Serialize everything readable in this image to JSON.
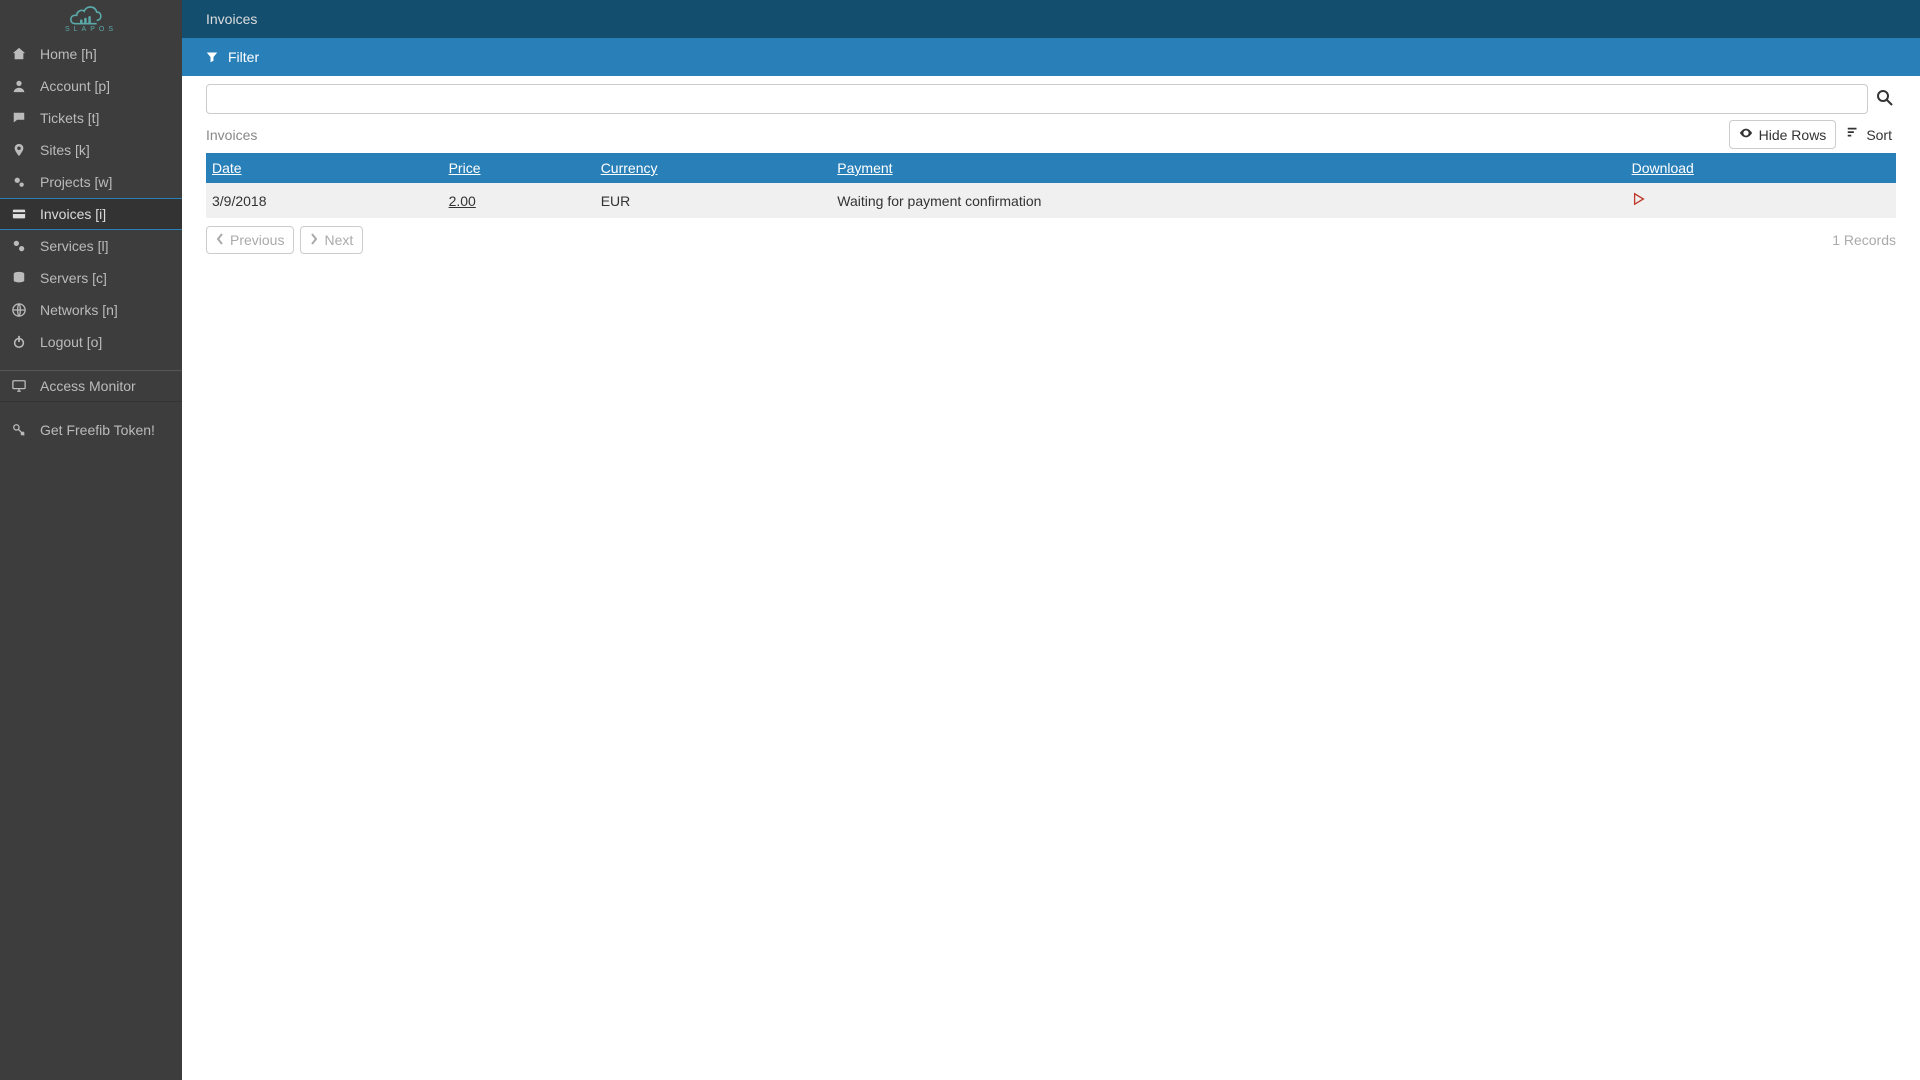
{
  "logo": {
    "text": "SLAPOS"
  },
  "sidebar": {
    "items": [
      {
        "label": "Home [h]",
        "icon": "home-icon"
      },
      {
        "label": "Account [p]",
        "icon": "user-icon"
      },
      {
        "label": "Tickets [t]",
        "icon": "chat-icon"
      },
      {
        "label": "Sites [k]",
        "icon": "pin-icon"
      },
      {
        "label": "Projects [w]",
        "icon": "gears-icon"
      },
      {
        "label": "Invoices [i]",
        "icon": "card-icon",
        "active": true
      },
      {
        "label": "Services [l]",
        "icon": "cogs-icon"
      },
      {
        "label": "Servers [c]",
        "icon": "db-icon"
      },
      {
        "label": "Networks [n]",
        "icon": "globe-icon"
      },
      {
        "label": "Logout [o]",
        "icon": "power-icon"
      }
    ],
    "extra": [
      {
        "label": "Access Monitor",
        "icon": "monitor-icon"
      },
      {
        "label": "Get Freefib Token!",
        "icon": "key-icon"
      }
    ]
  },
  "header": {
    "title": "Invoices"
  },
  "filterbar": {
    "label": "Filter"
  },
  "search": {
    "value": ""
  },
  "section": {
    "title": "Invoices",
    "hide_rows": "Hide Rows",
    "sort": "Sort"
  },
  "table": {
    "columns": {
      "date": "Date",
      "price": "Price",
      "currency": "Currency",
      "payment": "Payment",
      "download": "Download"
    },
    "rows": [
      {
        "date": "3/9/2018",
        "price": "2.00",
        "currency": "EUR",
        "payment": "Waiting for payment confirmation"
      }
    ]
  },
  "pager": {
    "previous": "Previous",
    "next": "Next",
    "records": "1 Records"
  }
}
